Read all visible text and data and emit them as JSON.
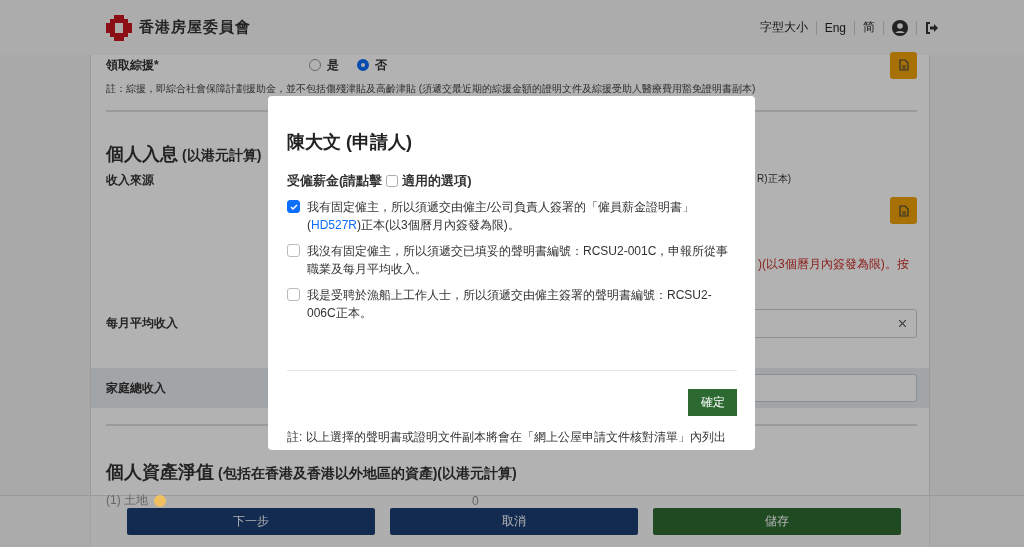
{
  "header": {
    "logo_text": "香港房屋委員會",
    "links": [
      "字型大小",
      "Eng",
      "简"
    ]
  },
  "cssa": {
    "label": "領取綜援*",
    "options": [
      {
        "label": "是",
        "selected": false
      },
      {
        "label": "否",
        "selected": true
      }
    ],
    "note": "註：綜援，即綜合社會保障計劃援助金，並不包括傷殘津貼及高齡津貼 (須遞交最近期的綜援金額的證明文件及綜援受助人醫療費用豁免證明書副本)"
  },
  "income": {
    "title": "個人入息",
    "subtitle": "(以港元計算)",
    "source_label": "收入來源",
    "source_note_fragment": "R)正本)",
    "warning_fragment": ")(以3個曆月內簽發為限)。按",
    "monthly_label": "每月平均收入",
    "household_label": "家庭總收入"
  },
  "assets": {
    "title": "個人資產淨值",
    "subtitle": "(包括在香港及香港以外地區的資產)(以港元計算)",
    "rows": [
      {
        "label": "(1) 土地",
        "value": "0"
      }
    ]
  },
  "footer_buttons": [
    {
      "label": "下一步",
      "kind": "primary"
    },
    {
      "label": "取消",
      "kind": "primary"
    },
    {
      "label": "儲存",
      "kind": "success"
    }
  ],
  "dialog": {
    "title": "陳大文 (申請人)",
    "heading_before": "受僱薪金(請點擊",
    "heading_after": "適用的選項)",
    "options": [
      {
        "text": "我有固定僱主，所以須遞交由僱主/公司負責人簽署的「僱員薪金證明書」(",
        "link": "HD527R",
        "text_after": ")正本(以3個曆月內簽發為限)。",
        "checked": true
      },
      {
        "text": "我沒有固定僱主，所以須遞交已填妥的聲明書編號：RCSU2-001C，申報所從事職業及每月平均收入。",
        "checked": false
      },
      {
        "text": "我是受聘於漁船上工作人士，所以須遞交由僱主簽署的聲明書編號：RCSU2-006C正本。",
        "checked": false
      }
    ],
    "confirm": "確定",
    "note": "註: 以上選擇的聲明書或證明文件副本將會在「網上公屋申請文件核對清單」內列出"
  }
}
